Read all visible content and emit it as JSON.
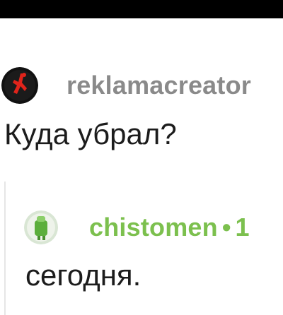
{
  "parent_comment": {
    "username": "reklamacreator",
    "text": "Куда убрал?"
  },
  "reply_comment": {
    "username": "chistomen",
    "separator": "•",
    "meta": "1",
    "text": "сегодня."
  },
  "colors": {
    "top_bar": "#000000",
    "parent_username": "#8a8a8a",
    "reply_username": "#7cc04e",
    "avatar_red": "#e0241b",
    "avatar_green": "#5cae3c",
    "text": "#1c1c1c"
  }
}
